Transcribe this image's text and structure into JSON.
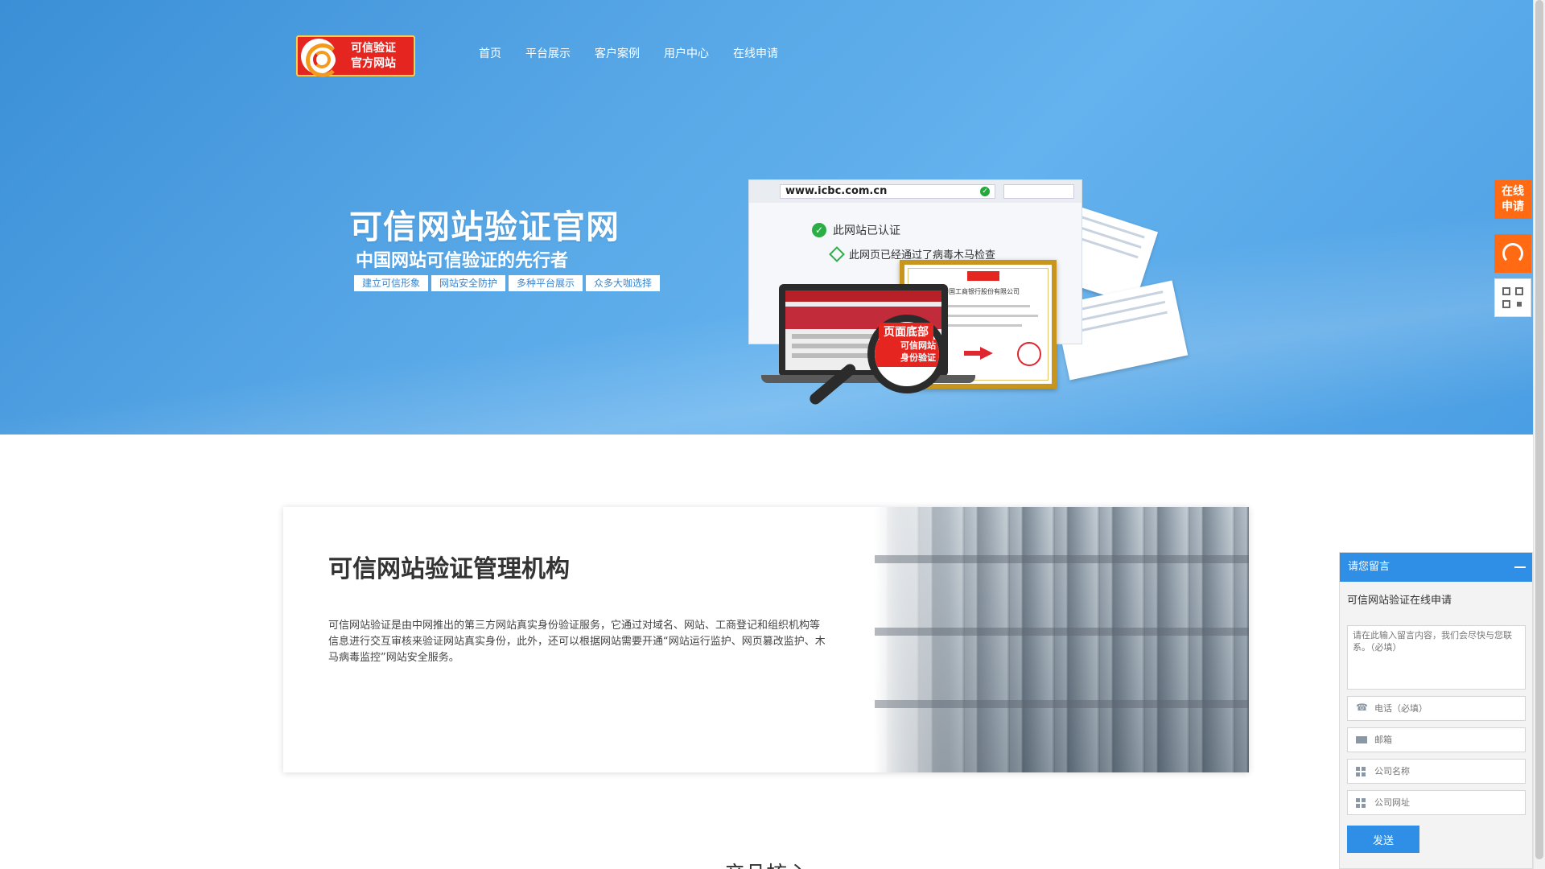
{
  "logo": {
    "line1": "可信验证",
    "line2": "官方网站"
  },
  "nav": [
    {
      "label": "首页"
    },
    {
      "label": "平台展示"
    },
    {
      "label": "客户案例"
    },
    {
      "label": "用户中心"
    },
    {
      "label": "在线申请"
    }
  ],
  "hero": {
    "title": "可信网站验证官网",
    "subtitle": "中国网站可信验证的先行者",
    "tags": [
      "建立可信形象",
      "网站安全防护",
      "多种平台展示",
      "众多大咖选择"
    ],
    "illustration": {
      "url": "www.icbc.com.cn",
      "verified_text": "此网站已认证",
      "scanned_text": "此网页已经通过了病毒木马检查",
      "page_bottom_label": "页面底部",
      "magnifier_text_1": "可信网站",
      "magnifier_text_2": "身份验证",
      "cert_company": "中国工商银行股份有限公司"
    }
  },
  "floating": {
    "apply_label_1": "在线",
    "apply_label_2": "申请"
  },
  "about": {
    "title": "可信网站验证管理机构",
    "description": "可信网站验证是由中网推出的第三方网站真实身份验证服务，它通过对域名、网站、工商登记和组织机构等信息进行交互审核来验证网站真实身份，此外，还可以根据网站需要开通“网站运行监护、网页篡改监护、木马病毒监控”网站安全服务。"
  },
  "next_section_title": "产品核心",
  "message_panel": {
    "title": "请您留言",
    "intro": "可信网站验证在线申请",
    "textarea_placeholder": "请在此输入留言内容，我们会尽快与您联系。（必填）",
    "phone_placeholder": "电话（必填）",
    "email_placeholder": "邮箱",
    "company_placeholder": "公司名称",
    "website_placeholder": "公司网址",
    "send_label": "发送"
  },
  "colors": {
    "hero_blue": "#56a6e6",
    "accent_orange": "#ff6a13",
    "panel_blue": "#2f8ee6",
    "logo_red": "#e52620"
  }
}
